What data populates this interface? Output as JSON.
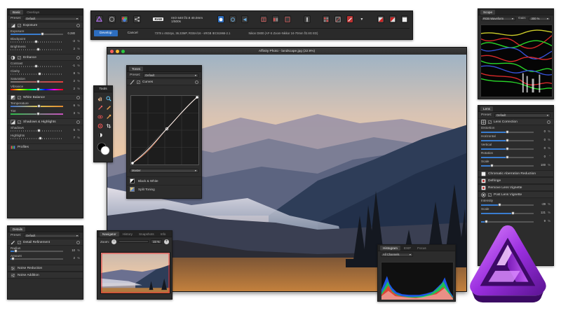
{
  "window": {
    "title": "Affinity Photo - landscape.jpg (22.9%)"
  },
  "toolbar": {
    "raw_badge": "RAW",
    "camera_settings": "ISO 640  f/2.8  40.0mm  1/500s",
    "develop_label": "Develop",
    "cancel_label": "Cancel",
    "image_info": "7378 x 4924px, 36.33MP, RGBA/16 - sRGB IEC61966-2.1",
    "lens_info": "Nikon D800 (AF-S Zoom-Nikkor 24-70mm f/2.8G ED)"
  },
  "basic_panel": {
    "tabs": [
      "Basic",
      "Overlays"
    ],
    "preset_label": "Preset:",
    "preset_value": "Default",
    "sections": {
      "exposure": {
        "title": "Exposure",
        "sliders": [
          {
            "label": "Exposure",
            "value": "0.280",
            "unit": ""
          },
          {
            "label": "Blackpoint",
            "value": "-2",
            "unit": "%"
          },
          {
            "label": "Brightness",
            "value": "2",
            "unit": "%"
          }
        ]
      },
      "enhance": {
        "title": "Enhance",
        "sliders": [
          {
            "label": "Contrast",
            "value": "-1",
            "unit": "%"
          },
          {
            "label": "Clarity",
            "value": "8",
            "unit": "%"
          },
          {
            "label": "Saturation",
            "value": "2",
            "unit": "%"
          },
          {
            "label": "Vibrance",
            "value": "2",
            "unit": "%"
          }
        ]
      },
      "white_balance": {
        "title": "White Balance",
        "sliders": [
          {
            "label": "Temperature",
            "value": "6",
            "unit": "%"
          },
          {
            "label": "Tint",
            "value": "3",
            "unit": "%"
          }
        ]
      },
      "shadows_highlights": {
        "title": "Shadows & Highlights",
        "sliders": [
          {
            "label": "Shadows",
            "value": "5",
            "unit": "%"
          },
          {
            "label": "Highlights",
            "value": "7",
            "unit": "%"
          }
        ]
      },
      "profiles": {
        "title": "Profiles"
      }
    }
  },
  "details_panel": {
    "tab": "Details",
    "preset_label": "Preset:",
    "preset_value": "Default",
    "section_title": "Detail Refinement",
    "sliders": [
      {
        "label": "Radius",
        "value": "10",
        "unit": "%"
      },
      {
        "label": "Amount",
        "value": "2",
        "unit": "%"
      }
    ],
    "noise_reduction": "Noise Reduction",
    "noise_addition": "Noise Addition"
  },
  "tools_panel": {
    "title": "Tools"
  },
  "tones_panel": {
    "title": "Tones",
    "preset_label": "Preset:",
    "preset_value": "Default",
    "curves_label": "Curves",
    "channel_value": "Master",
    "black_white_label": "Black & White",
    "split_toning_label": "Split Toning"
  },
  "navigator_panel": {
    "tabs": [
      "Navigator",
      "History",
      "Snapshots",
      "Info"
    ],
    "zoom_label": "Zoom:",
    "zoom_value": "23 %"
  },
  "scope_panel": {
    "title": "Scope",
    "mode_value": "RGB Waveform",
    "gain_label": "Gain:",
    "gain_value": "300 %"
  },
  "lens_panel": {
    "title": "Lens",
    "preset_label": "Preset:",
    "preset_value": "Default",
    "lens_correction_label": "Lens Correction",
    "sliders": [
      {
        "label": "Distortion",
        "value": "0",
        "unit": "%"
      },
      {
        "label": "Horizontal",
        "value": "0",
        "unit": "%"
      },
      {
        "label": "Vertical",
        "value": "0",
        "unit": "%"
      },
      {
        "label": "Rotation",
        "value": "0",
        "unit": "°"
      },
      {
        "label": "Scale",
        "value": "100",
        "unit": "%"
      }
    ],
    "chromatic_label": "Chromatic Aberration Reduction",
    "defringe_label": "Defringe",
    "vignette_removal_label": "Remove Lens Vignette",
    "post_vignette_label": "Post Lens Vignette",
    "intensity_label": "Intensity",
    "intensity_value": "-29",
    "intensity_unit": "%",
    "scale2_label": "Scale",
    "scale2_value": "121",
    "scale2_unit": "%",
    "extra_value": "9",
    "extra_unit": "%"
  },
  "histogram_panel": {
    "tabs": [
      "Histogram",
      "EXIF",
      "Focus"
    ],
    "channel_value": "All Channels"
  },
  "colors": {
    "accent": "#2d6ec0",
    "panel_bg": "#2c2c2c",
    "logo_purple": "#8a2be2"
  }
}
